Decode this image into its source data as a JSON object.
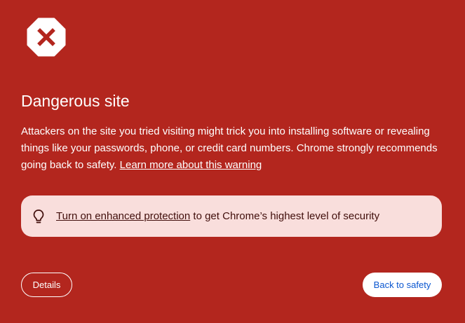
{
  "colors": {
    "background": "#b3261e",
    "tip_background": "#f9dedc",
    "tip_text": "#410e0b",
    "primary_button_text": "#0b57d0",
    "white": "#ffffff"
  },
  "header": {
    "icon": "danger-stop-icon",
    "title": "Dangerous site"
  },
  "body": {
    "text": "Attackers on the site you tried visiting might trick you into installing software or revealing things like your passwords, phone, or credit card numbers. Chrome strongly recommends going back to safety. ",
    "learn_more_link": "Learn more about this warning"
  },
  "tip": {
    "icon": "lightbulb-icon",
    "link_text": "Turn on enhanced protection",
    "text": " to get Chrome’s highest level of security"
  },
  "buttons": {
    "details_label": "Details",
    "back_label": "Back to safety"
  }
}
